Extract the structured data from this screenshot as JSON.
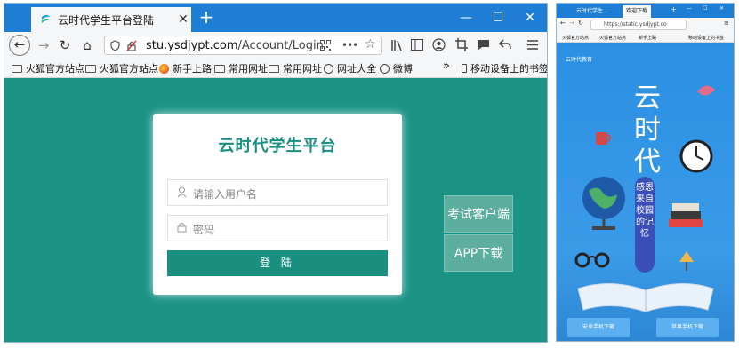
{
  "left_window": {
    "tab_title": "云时代学生平台登陆",
    "tab_close": "✕",
    "new_tab": "+",
    "window_controls": {
      "minimize": "—",
      "maximize": "☐",
      "close": "✕"
    },
    "nav": {
      "back": "←",
      "forward": "→",
      "reload": "↻",
      "home": "⌂"
    },
    "url": {
      "host": "stu.ysdjypt.com",
      "path": "/Account/Login"
    },
    "url_icons": {
      "more": "•••",
      "star": "☆"
    },
    "bookmarks": [
      "火狐官方站点",
      "火狐官方站点",
      "新手上路",
      "常用网址",
      "常用网址",
      "网址大全",
      "微博"
    ],
    "bookmark_overflow": "»",
    "mobile_bookmarks": "移动设备上的书签",
    "login": {
      "title": "云时代学生平台",
      "username_placeholder": "请输入用户名",
      "password_placeholder": "密码",
      "submit_label": "登 陆"
    },
    "side_buttons": [
      "考试客户端",
      "APP下载"
    ],
    "colors": {
      "tabbar": "#1e7ed6",
      "page_bg": "#1a9385",
      "accent": "#1a8f80"
    }
  },
  "right_window": {
    "tabs": [
      "云时代学生...",
      "欢迎下载"
    ],
    "url": "https://static.ysdjypt.co",
    "bookmarks": [
      "火狐官方站点",
      "火狐官方站点",
      "新手上路",
      "移动设备上的书签"
    ],
    "brand": "云时代教育",
    "big_text": [
      "云",
      "时",
      "代"
    ],
    "slogan": "感恩来自校园的记忆",
    "download_buttons": [
      "安卓手机下载",
      "苹果手机下载"
    ],
    "colors": {
      "bg": "#2a8ce0",
      "slogan_bg": "#3a4fb8",
      "button": "#5cb0f0"
    }
  }
}
